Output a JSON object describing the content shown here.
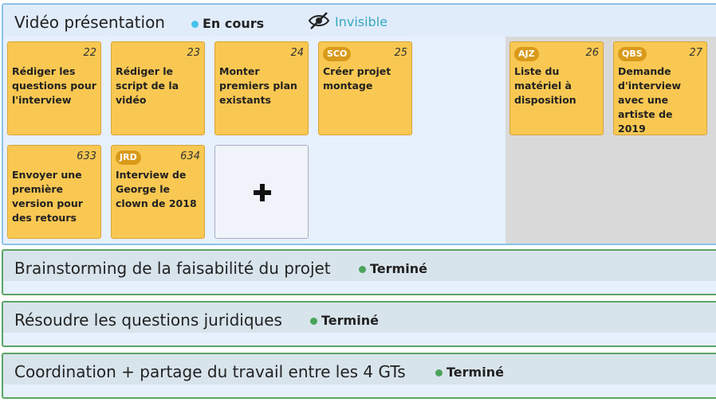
{
  "active_group": {
    "title": "Vidéo présentation",
    "status": {
      "label": "En cours",
      "color": "#48c2ec"
    },
    "visibility": {
      "label": "Invisible",
      "icon": "eye-slash-icon"
    },
    "cards": [
      {
        "num": "22",
        "badge": "",
        "text": "Rédiger les questions pour l'interview"
      },
      {
        "num": "23",
        "badge": "",
        "text": "Rédiger le script de la vidéo"
      },
      {
        "num": "24",
        "badge": "",
        "text": "Monter premiers plan existants"
      },
      {
        "num": "25",
        "badge": "SCO",
        "text": "Créer projet montage"
      },
      {
        "num": "26",
        "badge": "AJZ",
        "text": "Liste du matériel à disposition"
      },
      {
        "num": "27",
        "badge": "QBS",
        "text": "Demande d'interview avec une artiste de 2019"
      },
      {
        "num": "633",
        "badge": "",
        "text": "Envoyer une première version pour des retours"
      },
      {
        "num": "634",
        "badge": "JRD",
        "text": "Interview de George le clown de 2018"
      }
    ],
    "add_icon": "plus-icon"
  },
  "done_groups": [
    {
      "title": "Brainstorming de la faisabilité du projet",
      "status": "Terminé"
    },
    {
      "title": "Résoudre les questions juridiques",
      "status": "Terminé"
    },
    {
      "title": "Coordination + partage du travail entre les 4 GTs",
      "status": "Terminé"
    }
  ],
  "colors": {
    "done_dot": "#4aa35a",
    "card": "#f9c852",
    "badge": "#d99a1a"
  }
}
